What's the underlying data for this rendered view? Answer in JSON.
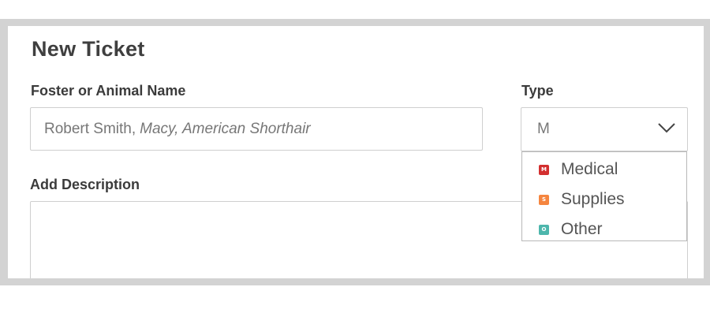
{
  "form": {
    "title": "New Ticket",
    "name_label": "Foster or Animal Name",
    "name_value_plain": "Robert Smith, ",
    "name_value_italic": "Macy, American Shorthair",
    "type_label": "Type",
    "type_value": "M",
    "description_label": "Add Description",
    "description_value": ""
  },
  "type_dropdown": {
    "options": [
      {
        "label": "Medical",
        "badge": "M",
        "color": "#d32f2f"
      },
      {
        "label": "Supplies",
        "badge": "S",
        "color": "#f5853f"
      },
      {
        "label": "Other",
        "badge": "O",
        "color": "#4db6ac"
      }
    ]
  },
  "icons": {
    "type_chevron": "chevron-down-icon"
  }
}
